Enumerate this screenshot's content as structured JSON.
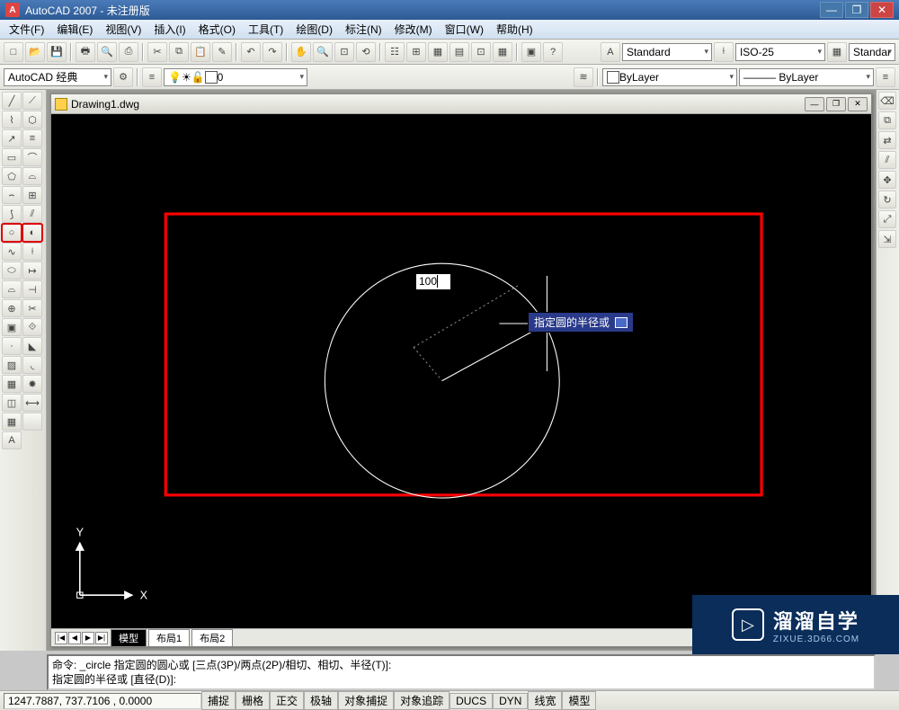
{
  "titlebar": {
    "app": "AutoCAD 2007",
    "suffix": "未注册版"
  },
  "menu": [
    {
      "l": "文件(F)"
    },
    {
      "l": "编辑(E)"
    },
    {
      "l": "视图(V)"
    },
    {
      "l": "插入(I)"
    },
    {
      "l": "格式(O)"
    },
    {
      "l": "工具(T)"
    },
    {
      "l": "绘图(D)"
    },
    {
      "l": "标注(N)"
    },
    {
      "l": "修改(M)"
    },
    {
      "l": "窗口(W)"
    },
    {
      "l": "帮助(H)"
    }
  ],
  "toolbar1": {
    "text_style": "Standard",
    "dim_style": "ISO-25",
    "right_style": "Standar"
  },
  "toolbar2": {
    "workspace": "AutoCAD 经典",
    "layer": "0",
    "color": "ByLayer",
    "linetype": "ByLayer"
  },
  "doc": {
    "title": "Drawing1.dwg"
  },
  "canvas": {
    "input_value": "100",
    "tooltip": "指定圆的半径或",
    "axis_x": "X",
    "axis_y": "Y"
  },
  "tabs": {
    "nav": [
      "|◀",
      "◀",
      "▶",
      "▶|"
    ],
    "items": [
      {
        "l": "模型",
        "active": true
      },
      {
        "l": "布局1",
        "active": false
      },
      {
        "l": "布局2",
        "active": false
      }
    ]
  },
  "cmd": {
    "line1": "命令: _circle 指定圆的圆心或 [三点(3P)/两点(2P)/相切、相切、半径(T)]:",
    "line2": "指定圆的半径或 [直径(D)]:"
  },
  "status": {
    "coords": "1247.7887, 737.7106 , 0.0000",
    "buttons": [
      "捕捉",
      "栅格",
      "正交",
      "极轴",
      "对象捕捉",
      "对象追踪",
      "DUCS",
      "DYN",
      "线宽",
      "模型"
    ]
  },
  "watermark": {
    "brand": "溜溜自学",
    "url": "ZIXUE.3D66.COM"
  }
}
